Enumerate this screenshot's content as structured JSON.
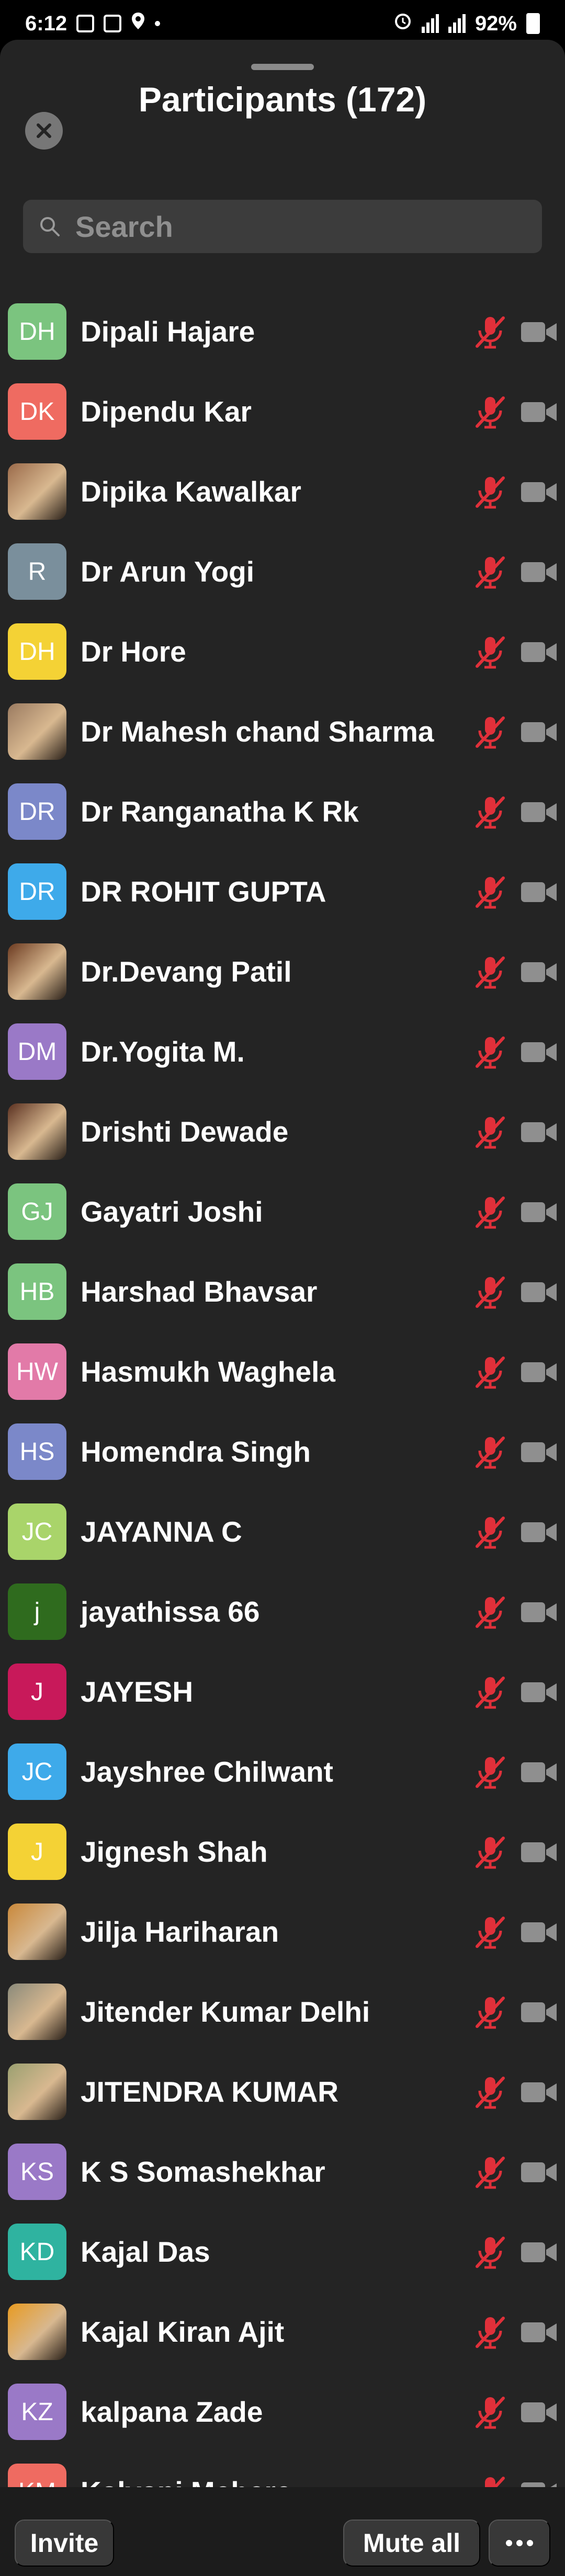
{
  "status_bar": {
    "time": "6:12",
    "battery": "92%"
  },
  "header": {
    "title": "Participants (172)"
  },
  "search": {
    "placeholder": "Search"
  },
  "colors": {
    "muted_mic": "#e0303a",
    "camera_off": "#8f8f8f",
    "sheet_bg": "#242424"
  },
  "participants": [
    {
      "initials": "DH",
      "name": "Dipali Hajare",
      "color": "#7bc47f",
      "photo": false
    },
    {
      "initials": "DK",
      "name": "Dipendu Kar",
      "color": "#ef6b61",
      "photo": false
    },
    {
      "initials": "",
      "name": "Dipika Kawalkar",
      "color": "#9a6a4a",
      "photo": true
    },
    {
      "initials": "R",
      "name": "Dr Arun Yogi",
      "color": "#7a8f9c",
      "photo": false
    },
    {
      "initials": "DH",
      "name": "Dr Hore",
      "color": "#f4d235",
      "photo": false
    },
    {
      "initials": "",
      "name": "Dr Mahesh chand Sharma",
      "color": "#9a7a60",
      "photo": true
    },
    {
      "initials": "DR",
      "name": "Dr Ranganatha K Rk",
      "color": "#7b88c9",
      "photo": false
    },
    {
      "initials": "DR",
      "name": "DR ROHIT GUPTA",
      "color": "#3eaaea",
      "photo": false
    },
    {
      "initials": "",
      "name": "Dr.Devang Patil",
      "color": "#6b3a20",
      "photo": true
    },
    {
      "initials": "DM",
      "name": "Dr.Yogita M.",
      "color": "#9a79c7",
      "photo": false
    },
    {
      "initials": "",
      "name": "Drishti Dewade",
      "color": "#5a3020",
      "photo": true
    },
    {
      "initials": "GJ",
      "name": "Gayatri Joshi",
      "color": "#7bc47f",
      "photo": false
    },
    {
      "initials": "HB",
      "name": "Harshad Bhavsar",
      "color": "#7bc47f",
      "photo": false
    },
    {
      "initials": "HW",
      "name": "Hasmukh Waghela",
      "color": "#e27aa8",
      "photo": false
    },
    {
      "initials": "HS",
      "name": "Homendra Singh",
      "color": "#7b88c9",
      "photo": false
    },
    {
      "initials": "JC",
      "name": "JAYANNA C",
      "color": "#a9d46a",
      "photo": false
    },
    {
      "initials": "j",
      "name": "jayathissa 66",
      "color": "#2f6b1e",
      "photo": false
    },
    {
      "initials": "J",
      "name": "JAYESH",
      "color": "#c8195a",
      "photo": false
    },
    {
      "initials": "JC",
      "name": "Jayshree Chilwant",
      "color": "#3eaaea",
      "photo": false
    },
    {
      "initials": "J",
      "name": "Jignesh  Shah",
      "color": "#f4d235",
      "photo": false
    },
    {
      "initials": "",
      "name": "Jilja Hariharan",
      "color": "#c9883a",
      "photo": true
    },
    {
      "initials": "",
      "name": "Jitender Kumar Delhi",
      "color": "#8a8a7a",
      "photo": true
    },
    {
      "initials": "",
      "name": "JITENDRA KUMAR",
      "color": "#9aa070",
      "photo": true
    },
    {
      "initials": "KS",
      "name": "K S Somashekhar",
      "color": "#9a79c7",
      "photo": false
    },
    {
      "initials": "KD",
      "name": "Kajal Das",
      "color": "#2fb3a0",
      "photo": false
    },
    {
      "initials": "",
      "name": "Kajal Kiran Ajit",
      "color": "#e89a20",
      "photo": true
    },
    {
      "initials": "KZ",
      "name": "kalpana Zade",
      "color": "#9a79c7",
      "photo": false
    },
    {
      "initials": "KM",
      "name": "Kalyani Mehere",
      "color": "#ef6b61",
      "photo": false
    }
  ],
  "footer": {
    "invite_label": "Invite",
    "mute_all_label": "Mute all"
  }
}
